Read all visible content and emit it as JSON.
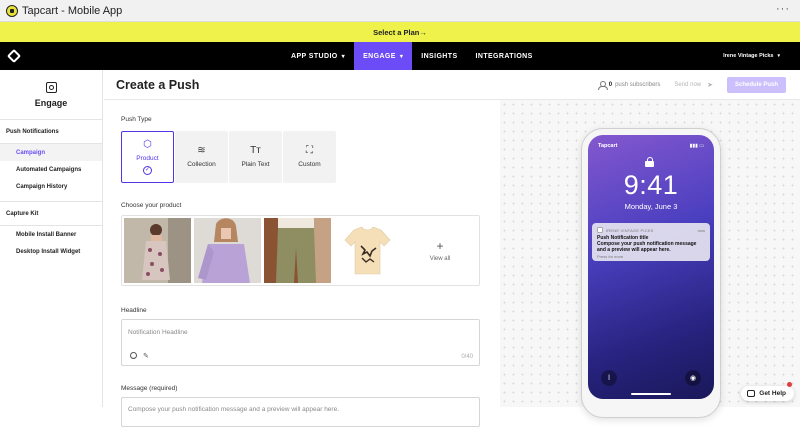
{
  "window": {
    "title": "Tapcart - Mobile App",
    "more_label": "···"
  },
  "banner": {
    "text": "Select a Plan→"
  },
  "topnav": {
    "items": [
      {
        "label": "APP STUDIO",
        "chevron": "▾"
      },
      {
        "label": "ENGAGE",
        "chevron": "▾"
      },
      {
        "label": "INSIGHTS"
      },
      {
        "label": "INTEGRATIONS"
      }
    ],
    "store_name": "Irene Vintage Picks",
    "store_chevron": "▾",
    "accent_color": "#6b4cf6"
  },
  "sidebar": {
    "title": "Engage",
    "sections": [
      {
        "title": "Push Notifications",
        "items": [
          "Campaign",
          "Automated Campaigns",
          "Campaign History"
        ]
      },
      {
        "title": "Capture Kit",
        "items": [
          "Mobile Install Banner",
          "Desktop Install Widget"
        ]
      }
    ]
  },
  "page": {
    "title": "Create a Push",
    "subscribers_count": "0",
    "subscribers_label": "push subscribers",
    "send_now_label": "Send now",
    "schedule_label": "Schedule Push"
  },
  "form": {
    "push_type_label": "Push Type",
    "push_types": [
      {
        "label": "Product",
        "icon": "cube-icon",
        "glyph": "⬡"
      },
      {
        "label": "Collection",
        "icon": "layers-icon",
        "glyph": "≋"
      },
      {
        "label": "Plain Text",
        "icon": "text-icon",
        "glyph": "Tт"
      },
      {
        "label": "Custom",
        "icon": "expand-icon",
        "glyph": "⛶"
      }
    ],
    "choose_product_label": "Choose your product",
    "view_all_label": "View all",
    "headline_label": "Headline",
    "headline_placeholder": "Notification Headline",
    "headline_value": "",
    "headline_counter": "0/40",
    "message_label": "Message (required)",
    "message_placeholder": "Compose your push notification message and a preview will appear here.",
    "message_value": ""
  },
  "preview": {
    "carrier": "Tapcart",
    "time": "9:41",
    "date": "Monday, June 3",
    "notification": {
      "store": "IRENE VINTAGE PICKS",
      "when": "now",
      "title": "Push Notification title",
      "body": "Compose your push notification message and a preview will appear here.",
      "more": "Press for more"
    }
  },
  "help": {
    "label": "Get Help"
  }
}
